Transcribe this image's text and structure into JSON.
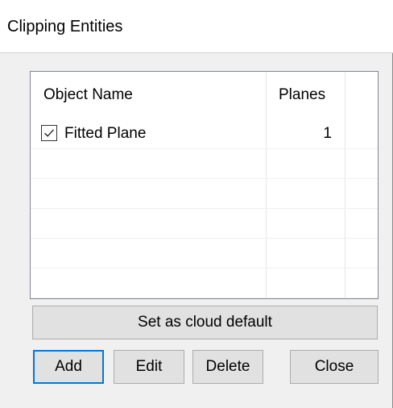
{
  "window": {
    "title": "Clipping Entities"
  },
  "list": {
    "columns": [
      {
        "label": "Object Name"
      },
      {
        "label": "Planes"
      }
    ],
    "rows": [
      {
        "checked": true,
        "name": "Fitted Plane",
        "planes": "1"
      }
    ]
  },
  "buttons": {
    "set_default": "Set as cloud default",
    "add": "Add",
    "edit": "Edit",
    "delete": "Delete",
    "close": "Close"
  },
  "colors": {
    "dialog_bg": "#f0f0f0",
    "button_bg": "#e1e1e1",
    "default_button_border": "#0078d7",
    "grid_line": "#f0f0f0"
  },
  "icons": {
    "checkbox": "checkmark-icon"
  }
}
